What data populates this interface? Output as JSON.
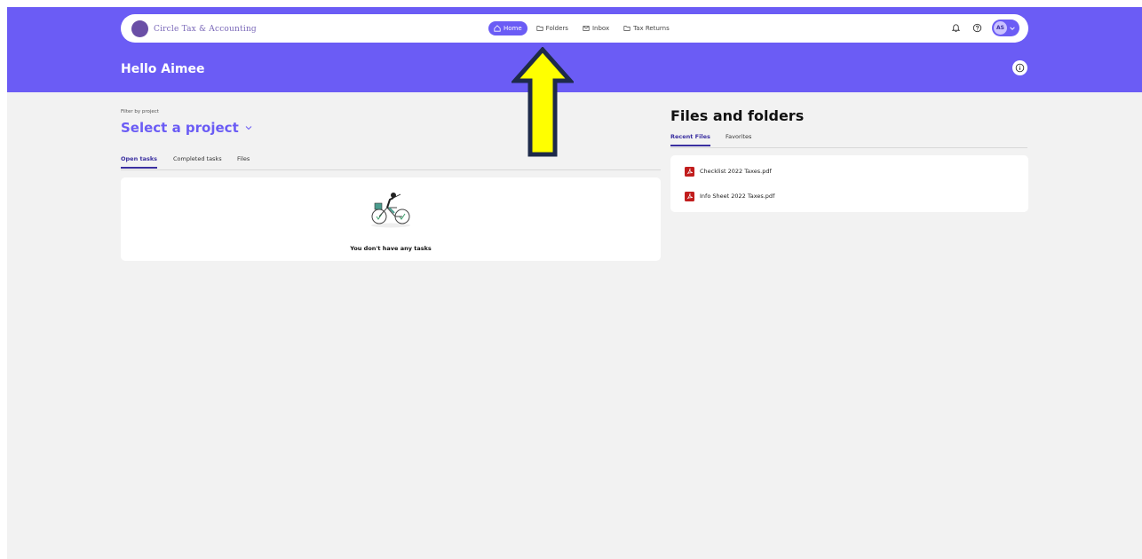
{
  "brand": {
    "name": "Circle Tax & Accounting"
  },
  "nav": {
    "links": [
      {
        "label": "Home",
        "icon": "home-icon",
        "active": true
      },
      {
        "label": "Folders",
        "icon": "folder-icon",
        "active": false
      },
      {
        "label": "Inbox",
        "icon": "mail-icon",
        "active": false
      },
      {
        "label": "Tax Returns",
        "icon": "folder-icon",
        "active": false
      }
    ],
    "avatar_initials": "AS"
  },
  "header": {
    "greeting": "Hello Aimee"
  },
  "tasks": {
    "filter_label": "Filter by project",
    "project_select": "Select a project",
    "tabs": [
      {
        "label": "Open tasks",
        "active": true
      },
      {
        "label": "Completed tasks",
        "active": false
      },
      {
        "label": "Files",
        "active": false
      }
    ],
    "empty_message": "You don't have any tasks"
  },
  "files": {
    "title": "Files and folders",
    "tabs": [
      {
        "label": "Recent Files",
        "active": true
      },
      {
        "label": "Favorites",
        "active": false
      }
    ],
    "items": [
      {
        "name": "Checklist 2022 Taxes.pdf",
        "icon": "pdf-icon"
      },
      {
        "name": "Info Sheet 2022 Taxes.pdf",
        "icon": "pdf-icon"
      }
    ]
  },
  "colors": {
    "accent": "#6b5cf5",
    "tab_active": "#3a2fa0",
    "pdf": "#c11d1d",
    "annotation_arrow": "#ffff00"
  }
}
